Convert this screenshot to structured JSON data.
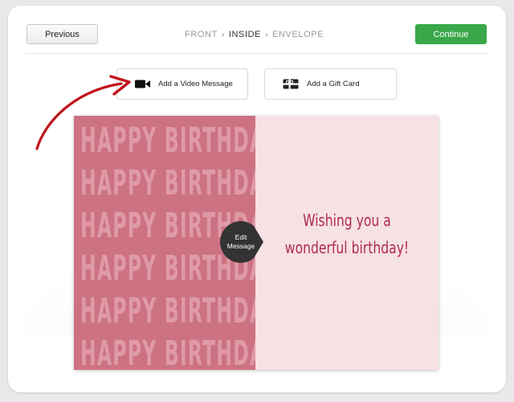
{
  "nav": {
    "previous_label": "Previous",
    "continue_label": "Continue",
    "steps": [
      "FRONT",
      "INSIDE",
      "ENVELOPE"
    ],
    "active_step": "INSIDE",
    "separator": "›"
  },
  "options": {
    "video_label": "Add a Video Message",
    "gift_label": "Add a Gift Card"
  },
  "card": {
    "pattern_text": "HAPPY BIRTHDAY",
    "message_line1": "Wishing you a",
    "message_line2": "wonderful birthday!",
    "edit_button": [
      "Edit",
      "Message"
    ]
  },
  "colors": {
    "continue_button": "#3aa84a",
    "card_left": "#cc7282",
    "card_right": "#f6e1e5",
    "message_text": "#b02a4f",
    "arrow": "#c0131c",
    "edit_button": "#333333"
  },
  "icons": {
    "video": "video-camera-icon",
    "gift": "gift-card-icon",
    "annotation": "curved-arrow-icon"
  }
}
